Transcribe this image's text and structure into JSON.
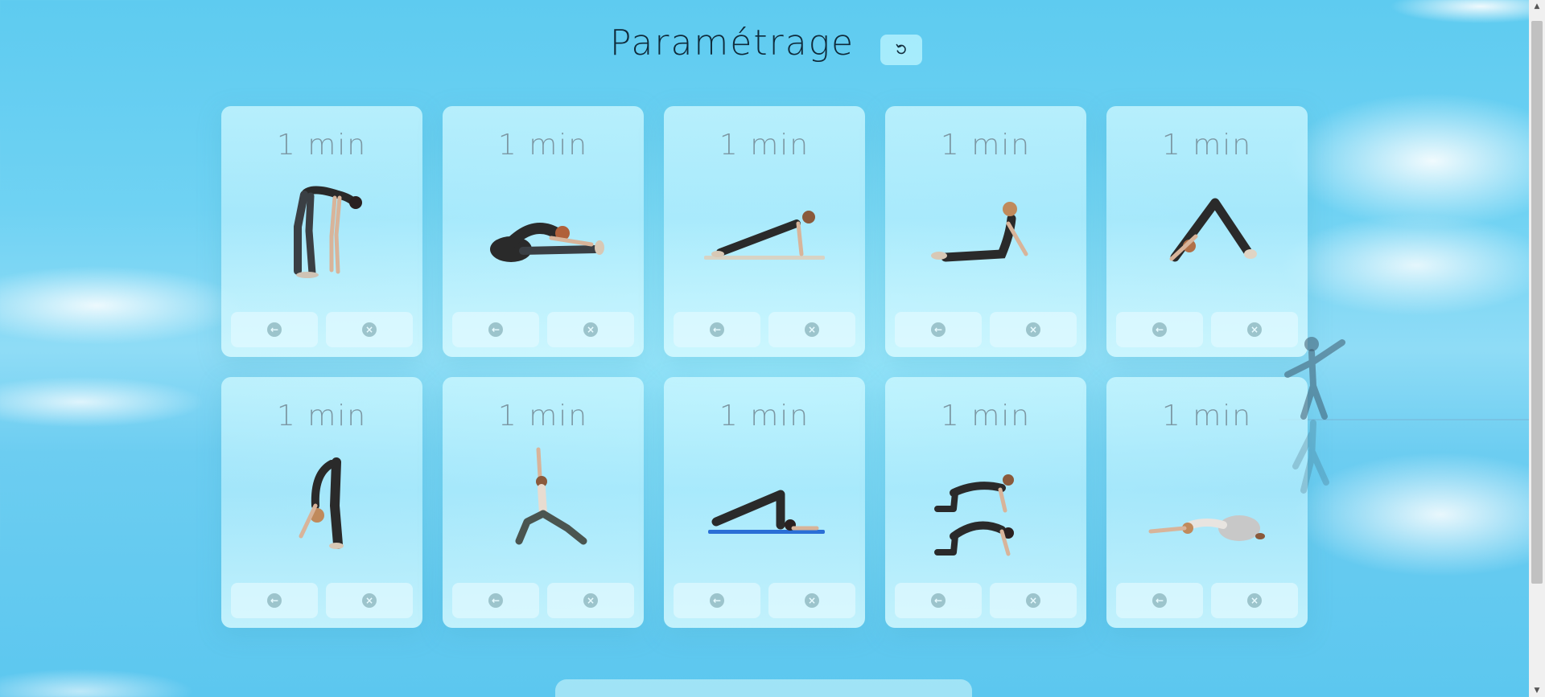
{
  "header": {
    "title": "Paramétrage",
    "reset_icon": "reset-icon"
  },
  "cards": [
    {
      "duration": "1 min",
      "pose": "standing-forward-fold"
    },
    {
      "duration": "1 min",
      "pose": "seated-forward-bend"
    },
    {
      "duration": "1 min",
      "pose": "plank"
    },
    {
      "duration": "1 min",
      "pose": "cobra"
    },
    {
      "duration": "1 min",
      "pose": "downward-dog"
    },
    {
      "duration": "1 min",
      "pose": "deep-forward-fold"
    },
    {
      "duration": "1 min",
      "pose": "warrior-one"
    },
    {
      "duration": "1 min",
      "pose": "plow"
    },
    {
      "duration": "1 min",
      "pose": "cat-cow"
    },
    {
      "duration": "1 min",
      "pose": "childs-pose"
    }
  ],
  "card_buttons": {
    "back_icon": "arrow-left-icon",
    "remove_icon": "close-icon"
  },
  "colors": {
    "title": "#0f2a3a",
    "duration_text": "#7c97a3",
    "button_icon": "#9cc4cc",
    "sky": "#6fd2f3"
  }
}
